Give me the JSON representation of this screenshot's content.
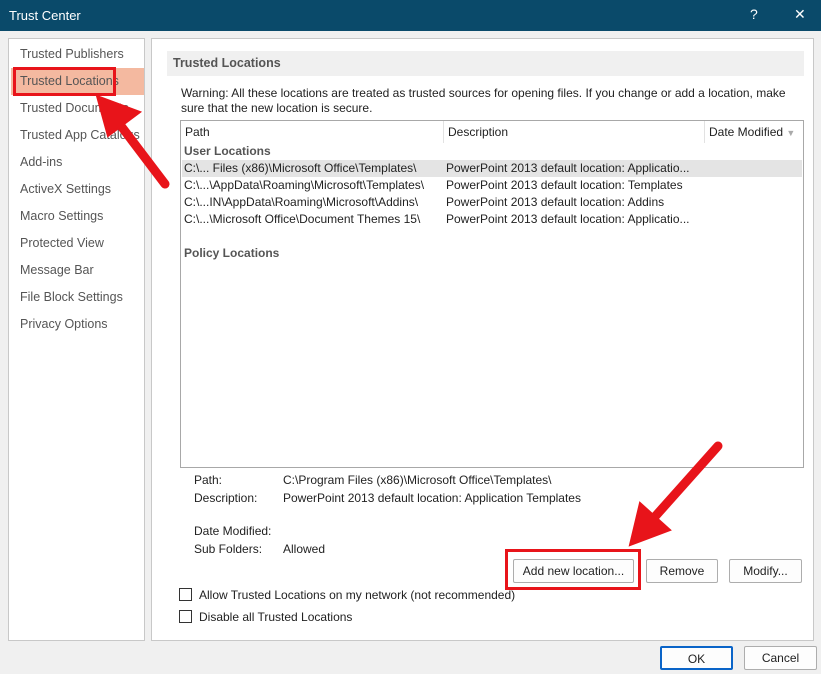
{
  "window": {
    "title": "Trust Center",
    "help": "?",
    "close": "✕"
  },
  "sidebar": {
    "items": [
      {
        "label": "Trusted Publishers"
      },
      {
        "label": "Trusted Locations",
        "selected": true
      },
      {
        "label": "Trusted Documents"
      },
      {
        "label": "Trusted App Catalogs"
      },
      {
        "label": "Add-ins"
      },
      {
        "label": "ActiveX Settings"
      },
      {
        "label": "Macro Settings"
      },
      {
        "label": "Protected View"
      },
      {
        "label": "Message Bar"
      },
      {
        "label": "File Block Settings"
      },
      {
        "label": "Privacy Options"
      }
    ]
  },
  "main": {
    "section_title": "Trusted Locations",
    "warning": "Warning: All these locations are treated as trusted sources for opening files.  If you change or add a location, make sure that the new location is secure.",
    "columns": [
      "Path",
      "Description",
      "Date Modified"
    ],
    "user_group": "User Locations",
    "rows": [
      {
        "path": "C:\\... Files (x86)\\Microsoft Office\\Templates\\",
        "description": "PowerPoint 2013 default location: Applicatio...",
        "selected": true
      },
      {
        "path": "C:\\...\\AppData\\Roaming\\Microsoft\\Templates\\",
        "description": "PowerPoint 2013 default location: Templates"
      },
      {
        "path": "C:\\...IN\\AppData\\Roaming\\Microsoft\\Addins\\",
        "description": "PowerPoint 2013 default location: Addins"
      },
      {
        "path": "C:\\...\\Microsoft Office\\Document Themes 15\\",
        "description": "PowerPoint 2013 default location: Applicatio..."
      }
    ],
    "policy_group": "Policy Locations",
    "details": {
      "path_label": "Path:",
      "path": "C:\\Program Files (x86)\\Microsoft Office\\Templates\\",
      "desc_label": "Description:",
      "desc": "PowerPoint 2013 default location: Application Templates",
      "date_label": "Date Modified:",
      "sub_label": "Sub Folders:",
      "sub": "Allowed"
    },
    "buttons": {
      "add": "Add new location...",
      "remove": "Remove",
      "modify": "Modify..."
    },
    "checkboxes": [
      {
        "label": "Allow Trusted Locations on my network (not recommended)",
        "checked": false
      },
      {
        "label": "Disable all Trusted Locations",
        "checked": false
      }
    ]
  },
  "footer": {
    "ok": "OK",
    "cancel": "Cancel"
  },
  "colors": {
    "titlebar": "#0a4a6a",
    "selection": "#f4b9a0",
    "annotation": "#e8141a"
  }
}
